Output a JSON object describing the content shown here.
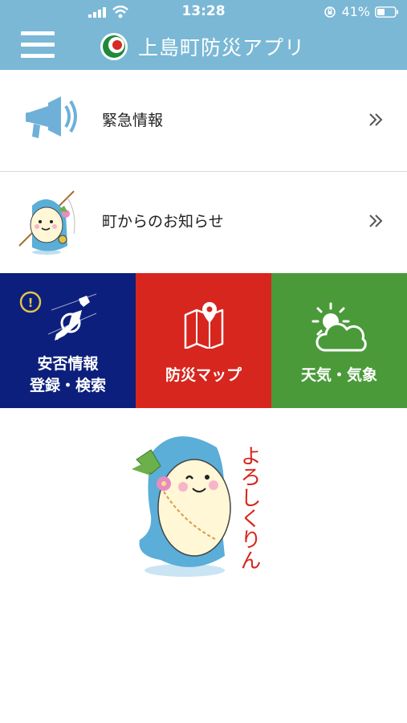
{
  "status_bar": {
    "time": "13:28",
    "battery": "41%"
  },
  "header": {
    "title": "上島町防災アプリ"
  },
  "menu_items": [
    {
      "label": "緊急情報",
      "icon": "megaphone-icon"
    },
    {
      "label": "町からのお知らせ",
      "icon": "mascot-fishing-icon"
    }
  ],
  "tiles": [
    {
      "line1": "安否情報",
      "line2": "登録・検索",
      "color": "#0c1f7c",
      "icon": "japan-map-search-icon"
    },
    {
      "label": "防災マップ",
      "color": "#d7261e",
      "icon": "map-pin-icon"
    },
    {
      "label": "天気・気象",
      "color": "#4a9a3a",
      "icon": "sun-cloud-icon"
    }
  ],
  "mascot": {
    "text": "よろしくりん"
  },
  "colors": {
    "header": "#7ab8d6",
    "chevron": "#555555"
  }
}
